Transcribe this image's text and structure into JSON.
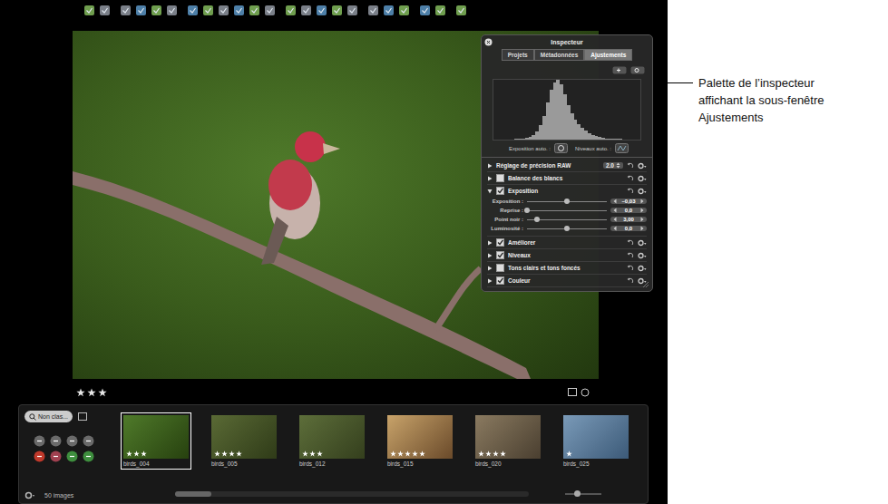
{
  "viewer": {
    "stars": 3
  },
  "inspector": {
    "title": "Inspecteur",
    "tabs": [
      {
        "label": "Projets",
        "selected": false
      },
      {
        "label": "Métadonnées",
        "selected": false
      },
      {
        "label": "Ajustements",
        "selected": true
      }
    ],
    "histogram": [
      0,
      0,
      0,
      0,
      0,
      1,
      1,
      2,
      3,
      5,
      8,
      14,
      24,
      40,
      62,
      84,
      96,
      100,
      92,
      76,
      58,
      44,
      34,
      26,
      20,
      15,
      11,
      8,
      6,
      4,
      3,
      2,
      2,
      1,
      1,
      1,
      0,
      0,
      0,
      0
    ],
    "auto": [
      {
        "label": "Exposition auto. :"
      },
      {
        "label": "Niveaux auto. :"
      }
    ],
    "sections": [
      {
        "label": "Réglage de précision RAW",
        "kind": "value",
        "value": "2.0",
        "expanded": false
      },
      {
        "label": "Balance des blancs",
        "kind": "check",
        "checked": false,
        "expanded": false
      },
      {
        "label": "Exposition",
        "kind": "check",
        "checked": true,
        "expanded": true,
        "sliders": [
          {
            "label": "Exposition :",
            "level": 0.5,
            "reading": "–0,03"
          },
          {
            "label": "Reprise :",
            "level": 0.0,
            "reading": "0,0"
          },
          {
            "label": "Point noir :",
            "level": 0.12,
            "reading": "3,00"
          },
          {
            "label": "Luminosité :",
            "level": 0.5,
            "reading": "0,0"
          }
        ]
      },
      {
        "label": "Améliorer",
        "kind": "check",
        "checked": true,
        "expanded": false
      },
      {
        "label": "Niveaux",
        "kind": "check",
        "checked": true,
        "expanded": false
      },
      {
        "label": "Tons clairs et tons foncés",
        "kind": "check",
        "checked": false,
        "expanded": false
      },
      {
        "label": "Couleur",
        "kind": "check",
        "checked": true,
        "expanded": false
      }
    ]
  },
  "filmstrip": {
    "search": {
      "value": "Non clas..."
    },
    "count": "50 images",
    "thumbnails": [
      {
        "name": "birds_004",
        "stars": 3,
        "selected": true
      },
      {
        "name": "birds_005",
        "stars": 4,
        "selected": false
      },
      {
        "name": "birds_012",
        "stars": 3,
        "selected": false
      },
      {
        "name": "birds_015",
        "stars": 5,
        "selected": false
      },
      {
        "name": "birds_020",
        "stars": 4,
        "selected": false
      },
      {
        "name": "birds_025",
        "stars": 1,
        "selected": false
      }
    ]
  },
  "callout": {
    "lines": [
      "Palette de l’inspecteur",
      "affichant la sous-fenêtre",
      "Ajustements"
    ]
  }
}
